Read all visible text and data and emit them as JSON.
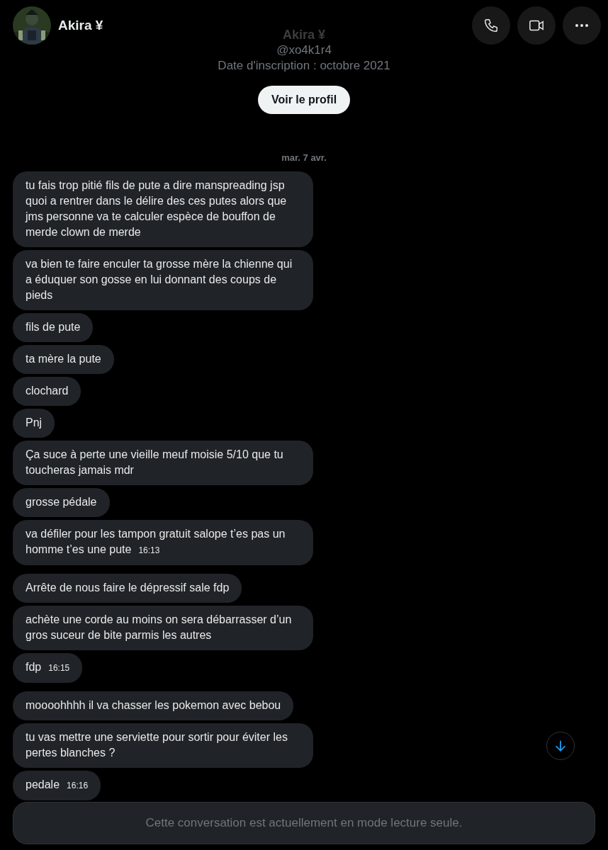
{
  "header": {
    "name": "Akira ¥"
  },
  "profile": {
    "name": "Akira ¥",
    "handle": "@xo4k1r4",
    "joined": "Date d'inscription : octobre 2021",
    "button": "Voir le profil"
  },
  "date_separator": "mar. 7 avr.",
  "messages": [
    {
      "text": "tu fais trop pitié fils de pute a dire manspreading jsp quoi a rentrer dans le délire des ces putes alors que jms personne va te calculer espèce de bouffon de merde clown de merde"
    },
    {
      "text": "va bien te faire enculer ta grosse mère la chienne qui a éduquer son gosse en lui donnant des coups de pieds"
    },
    {
      "text": "fils de pute"
    },
    {
      "text": "ta mère la pute"
    },
    {
      "text": "clochard"
    },
    {
      "text": "Pnj"
    },
    {
      "text": "Ça suce à perte une vieille meuf moisie 5/10 que tu toucheras jamais mdr"
    },
    {
      "text": "grosse pédale"
    },
    {
      "text": "va défiler pour les tampon gratuit salope t’es pas un homme t’es une pute",
      "time": "16:13"
    },
    {
      "text": "Arrête de nous faire le dépressif sale fdp"
    },
    {
      "text": "achète une corde au moins on sera débarrasser d’un gros suceur de bite parmis les autres"
    },
    {
      "text": "fdp",
      "time": "16:15"
    },
    {
      "text": "moooohhhh il va chasser les pokemon avec bebou"
    },
    {
      "text": "tu vas mettre une serviette pour sortir pour éviter les pertes blanches ?"
    },
    {
      "text": "pedale",
      "time": "16:16"
    }
  ],
  "footer": {
    "notice": "Cette conversation est actuellement en mode lecture seule."
  }
}
